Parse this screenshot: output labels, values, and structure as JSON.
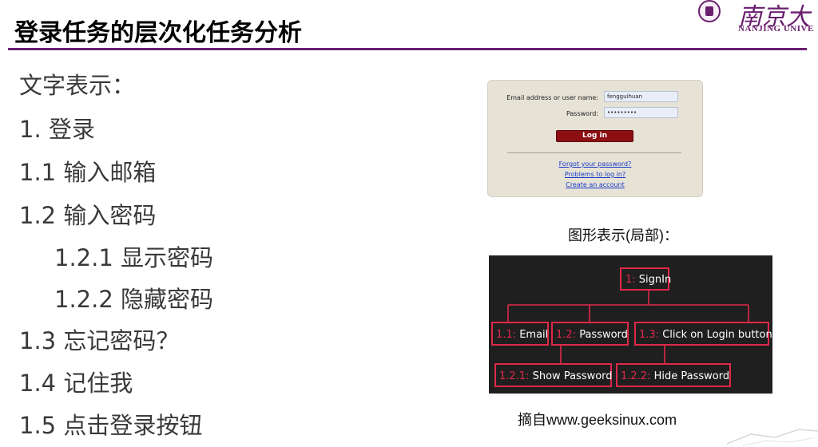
{
  "slide": {
    "title": "登录任务的层次化任务分析"
  },
  "logo": {
    "cn_text": "南京大",
    "en_text": "NANJING UNIVE"
  },
  "outline": [
    {
      "text": "文字表示：",
      "level": 0
    },
    {
      "text": "1. 登录",
      "level": 0
    },
    {
      "text": "1.1 输入邮箱",
      "level": 0
    },
    {
      "text": "1.2 输入密码",
      "level": 0
    },
    {
      "text": "1.2.1 显示密码",
      "level": 1
    },
    {
      "text": "1.2.2 隐藏密码",
      "level": 1
    },
    {
      "text": "1.3 忘记密码？",
      "level": 0
    },
    {
      "text": "1.4 记住我",
      "level": 0
    },
    {
      "text": "1.5 点击登录按钮",
      "level": 0
    }
  ],
  "login_form": {
    "email_label": "Email address or user name:",
    "email_value": "fengguihuan",
    "password_label": "Password:",
    "password_value": "•••••••••",
    "login_button": "Log in",
    "links": [
      "Forgot your password?",
      "Problems to log in?",
      "Create an account"
    ]
  },
  "graphic_caption": "图形表示(局部)：",
  "tree": {
    "nodes": [
      {
        "id": "1",
        "prefix": "1:",
        "label": "SignIn"
      },
      {
        "id": "1.1",
        "prefix": "1.1:",
        "label": "Email"
      },
      {
        "id": "1.2",
        "prefix": "1.2:",
        "label": "Password"
      },
      {
        "id": "1.3",
        "prefix": "1.3:",
        "label": "Click on Login button"
      },
      {
        "id": "1.2.1",
        "prefix": "1.2.1:",
        "label": "Show Password"
      },
      {
        "id": "1.2.2",
        "prefix": "1.2.2:",
        "label": "Hide Password"
      }
    ],
    "colors": {
      "background": "#1f1f1f",
      "accent": "#e0284a",
      "text": "#ffffff"
    }
  },
  "source_caption": "摘自www.geeksinux.com"
}
